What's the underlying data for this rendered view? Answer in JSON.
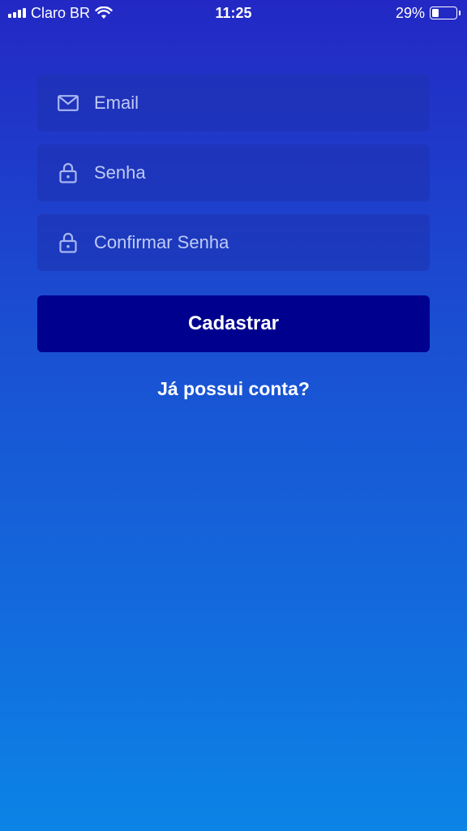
{
  "status_bar": {
    "carrier": "Claro BR",
    "time": "11:25",
    "battery_percent": "29%",
    "battery_level": 0.29,
    "icons": [
      "signal-icon",
      "wifi-icon",
      "battery-icon"
    ]
  },
  "form": {
    "email": {
      "placeholder": "Email",
      "value": "",
      "icon": "mail-icon"
    },
    "password": {
      "placeholder": "Senha",
      "value": "",
      "icon": "lock-icon"
    },
    "confirm_password": {
      "placeholder": "Confirmar Senha",
      "value": "",
      "icon": "lock-icon"
    },
    "submit_label": "Cadastrar",
    "login_link_label": "Já possui conta?"
  },
  "colors": {
    "background_top": "#2328c4",
    "background_bottom": "#0b84e6",
    "button_background": "#00008f",
    "icon_color": "#a9b6f2"
  }
}
